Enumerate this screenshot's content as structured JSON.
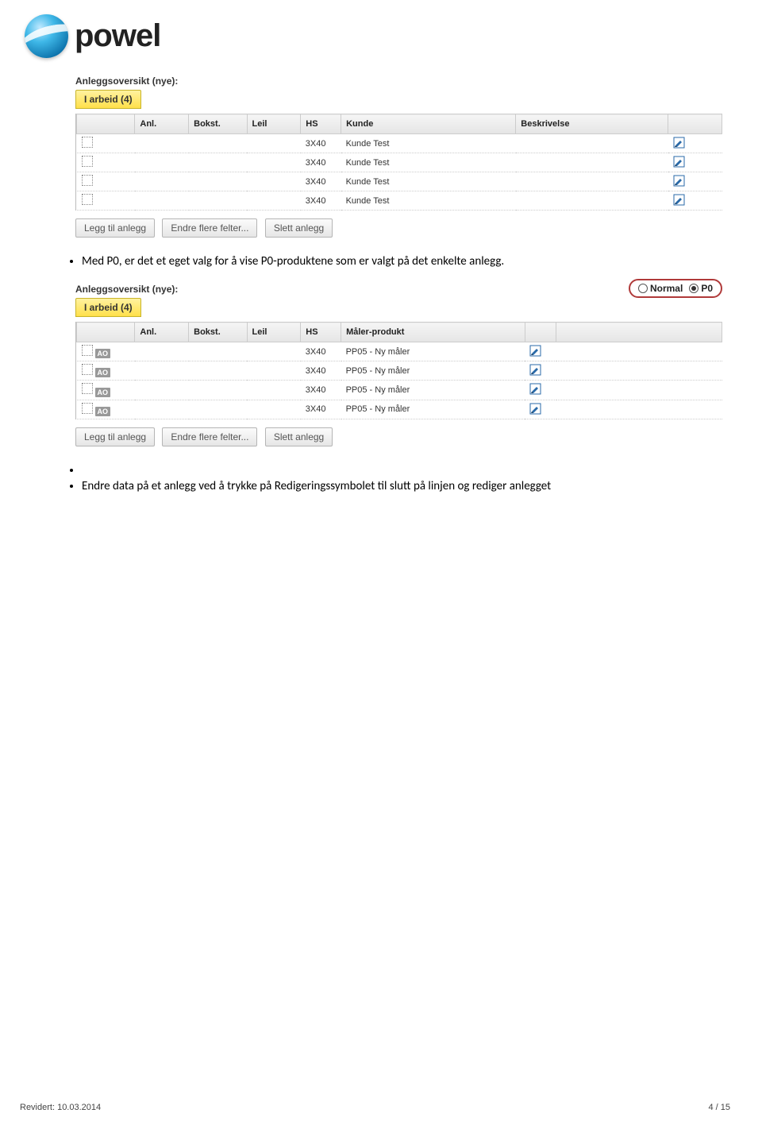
{
  "logo_text": "powel",
  "panel1": {
    "title": "Anleggsoversikt (nye):",
    "tab_label": "I arbeid (4)",
    "headers": [
      "",
      "Anl.",
      "Bokst.",
      "Leil",
      "HS",
      "Kunde",
      "Beskrivelse",
      ""
    ],
    "rows": [
      {
        "hs": "3X40",
        "kunde": "Kunde Test"
      },
      {
        "hs": "3X40",
        "kunde": "Kunde Test"
      },
      {
        "hs": "3X40",
        "kunde": "Kunde Test"
      },
      {
        "hs": "3X40",
        "kunde": "Kunde Test"
      }
    ],
    "buttons": [
      "Legg til anlegg",
      "Endre flere felter...",
      "Slett anlegg"
    ]
  },
  "bullet1": "Med P0, er det et eget valg for å vise P0-produktene som er valgt på det enkelte anlegg.",
  "panel2": {
    "title": "Anleggsoversikt (nye):",
    "tab_label": "I arbeid (4)",
    "radio": {
      "normal": "Normal",
      "p0": "P0"
    },
    "headers": [
      "",
      "Anl.",
      "Bokst.",
      "Leil",
      "HS",
      "Måler-produkt",
      "",
      ""
    ],
    "badge": "AO",
    "rows": [
      {
        "hs": "3X40",
        "mp": "PP05 - Ny måler"
      },
      {
        "hs": "3X40",
        "mp": "PP05 - Ny måler"
      },
      {
        "hs": "3X40",
        "mp": "PP05 - Ny måler"
      },
      {
        "hs": "3X40",
        "mp": "PP05 - Ny måler"
      }
    ],
    "buttons": [
      "Legg til anlegg",
      "Endre flere felter...",
      "Slett anlegg"
    ]
  },
  "bullet2": "Endre data på et anlegg ved å trykke på Redigeringssymbolet til slutt på linjen og rediger anlegget",
  "footer": "Revidert: 10.03.2014",
  "pagecount": "4 / 15"
}
